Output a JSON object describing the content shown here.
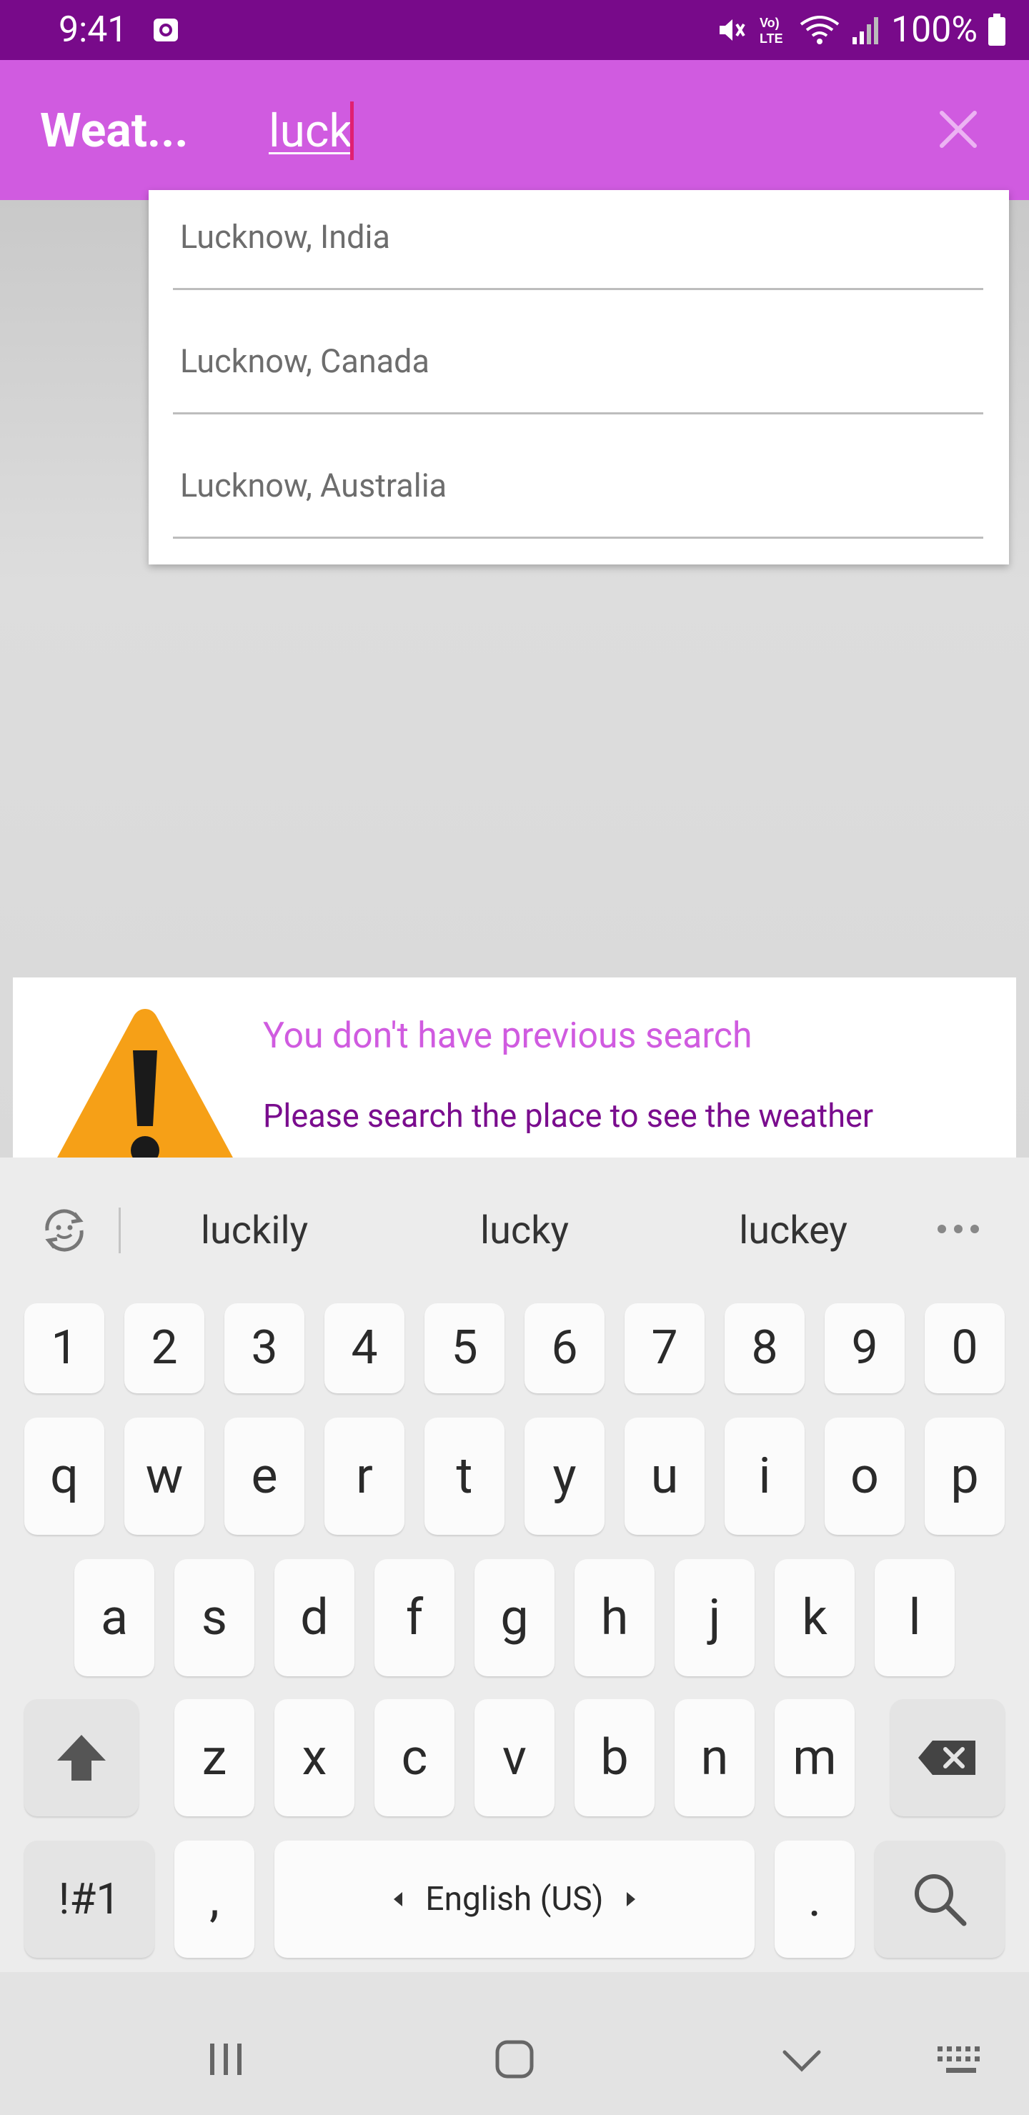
{
  "status_bar": {
    "time": "9:41",
    "battery": "100%"
  },
  "app_bar": {
    "title": "Weat...",
    "search_value": "luck"
  },
  "suggestions": [
    {
      "label": "Lucknow, India"
    },
    {
      "label": "Lucknow, Canada"
    },
    {
      "label": "Lucknow, Australia"
    }
  ],
  "card": {
    "title": "You don't have previous search",
    "subtitle": "Please search the place to see the weather"
  },
  "keyboard": {
    "word_suggestions": [
      "luckily",
      "lucky",
      "luckey"
    ],
    "number_row": [
      "1",
      "2",
      "3",
      "4",
      "5",
      "6",
      "7",
      "8",
      "9",
      "0"
    ],
    "row1": [
      "q",
      "w",
      "e",
      "r",
      "t",
      "y",
      "u",
      "i",
      "o",
      "p"
    ],
    "row2": [
      "a",
      "s",
      "d",
      "f",
      "g",
      "h",
      "j",
      "k",
      "l"
    ],
    "row3": [
      "z",
      "x",
      "c",
      "v",
      "b",
      "n",
      "m"
    ],
    "symbols_label": "!#1",
    "comma_label": ",",
    "space_label": "English (US)",
    "period_label": "."
  },
  "colors": {
    "status_bar": "#780a8a",
    "app_bar": "#d05be0",
    "accent_dark": "#7a0d8e"
  }
}
